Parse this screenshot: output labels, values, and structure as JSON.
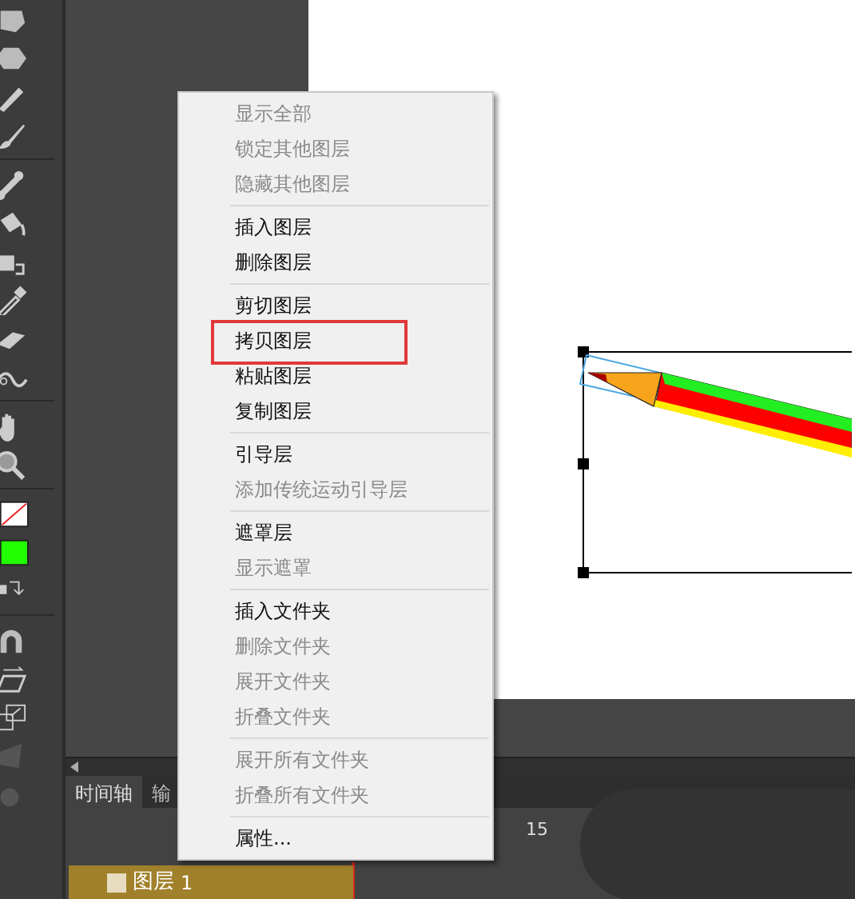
{
  "context_menu": {
    "groups": [
      {
        "items": [
          {
            "label": "显示全部",
            "disabled": true,
            "highlighted": false
          },
          {
            "label": "锁定其他图层",
            "disabled": true,
            "highlighted": false
          },
          {
            "label": "隐藏其他图层",
            "disabled": true,
            "highlighted": false
          }
        ]
      },
      {
        "items": [
          {
            "label": "插入图层",
            "disabled": false,
            "highlighted": false
          },
          {
            "label": "删除图层",
            "disabled": false,
            "highlighted": false
          }
        ]
      },
      {
        "items": [
          {
            "label": "剪切图层",
            "disabled": false,
            "highlighted": false
          },
          {
            "label": "拷贝图层",
            "disabled": false,
            "highlighted": true
          },
          {
            "label": "粘贴图层",
            "disabled": false,
            "highlighted": false
          },
          {
            "label": "复制图层",
            "disabled": false,
            "highlighted": false
          }
        ]
      },
      {
        "items": [
          {
            "label": "引导层",
            "disabled": false,
            "highlighted": false
          },
          {
            "label": "添加传统运动引导层",
            "disabled": true,
            "highlighted": false
          }
        ]
      },
      {
        "items": [
          {
            "label": "遮罩层",
            "disabled": false,
            "highlighted": false
          },
          {
            "label": "显示遮罩",
            "disabled": true,
            "highlighted": false
          }
        ]
      },
      {
        "items": [
          {
            "label": "插入文件夹",
            "disabled": false,
            "highlighted": false
          },
          {
            "label": "删除文件夹",
            "disabled": true,
            "highlighted": false
          },
          {
            "label": "展开文件夹",
            "disabled": true,
            "highlighted": false
          },
          {
            "label": "折叠文件夹",
            "disabled": true,
            "highlighted": false
          }
        ]
      },
      {
        "items": [
          {
            "label": "展开所有文件夹",
            "disabled": true,
            "highlighted": false
          },
          {
            "label": "折叠所有文件夹",
            "disabled": true,
            "highlighted": false
          }
        ]
      },
      {
        "items": [
          {
            "label": "属性...",
            "disabled": false,
            "highlighted": false
          }
        ]
      }
    ]
  },
  "timeline": {
    "tabs": [
      {
        "label": "时间轴",
        "selected": true
      },
      {
        "label": "输",
        "selected": false
      }
    ],
    "ruler_label": "15",
    "layer": {
      "name": "图层",
      "number": "1"
    }
  }
}
